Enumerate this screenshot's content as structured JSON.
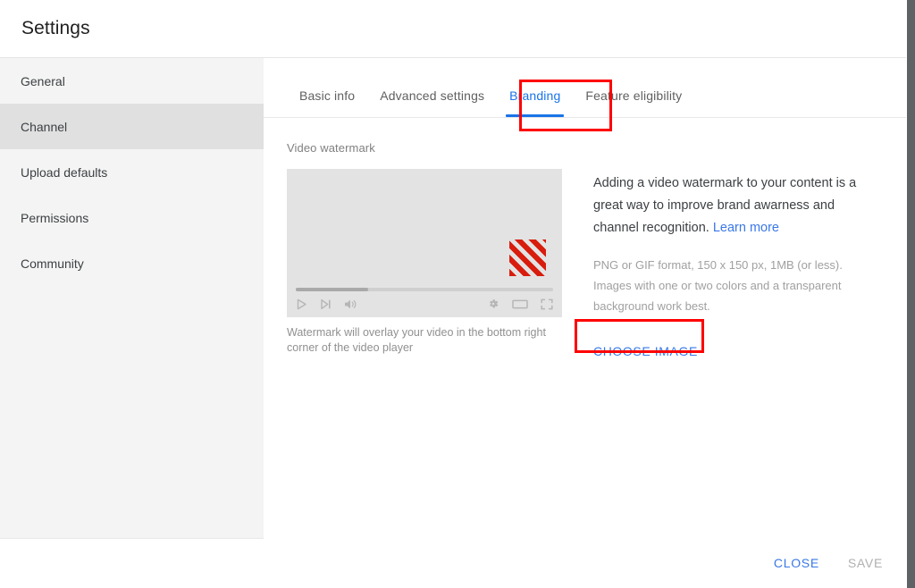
{
  "dialog": {
    "title": "Settings"
  },
  "sidebar": {
    "items": [
      {
        "label": "General",
        "active": false
      },
      {
        "label": "Channel",
        "active": true
      },
      {
        "label": "Upload defaults",
        "active": false
      },
      {
        "label": "Permissions",
        "active": false
      },
      {
        "label": "Community",
        "active": false
      }
    ]
  },
  "tabs": [
    {
      "label": "Basic info",
      "active": false
    },
    {
      "label": "Advanced settings",
      "active": false
    },
    {
      "label": "Branding",
      "active": true
    },
    {
      "label": "Feature eligibility",
      "active": false
    }
  ],
  "branding": {
    "section_label": "Video watermark",
    "preview_caption": "Watermark will overlay your video in the bottom right corner of the video player",
    "description_text": "Adding a video watermark to your content is a great way to improve brand awarness and channel recognition.",
    "learn_more_label": "Learn more",
    "requirements_text": "PNG or GIF format, 150 x 150 px, 1MB (or less). Images with one or two colors and a transparent background work best.",
    "choose_image_label": "CHOOSE IMAGE"
  },
  "player_controls": {
    "play": "play-icon",
    "next": "next-track-icon",
    "volume": "volume-icon",
    "settings": "gear-icon",
    "theater": "theater-mode-icon",
    "fullscreen": "fullscreen-icon",
    "progress_percent": 28
  },
  "footer": {
    "close_label": "CLOSE",
    "save_label": "SAVE"
  },
  "colors": {
    "accent_blue": "#3b78e7",
    "tab_active_blue": "#1a73e8",
    "annotation_red": "#fe0000",
    "watermark_red": "#d81d0e",
    "sidebar_bg": "#f4f4f4",
    "sidebar_active_bg": "#e0e0e0",
    "player_bg": "#e3e3e3"
  }
}
